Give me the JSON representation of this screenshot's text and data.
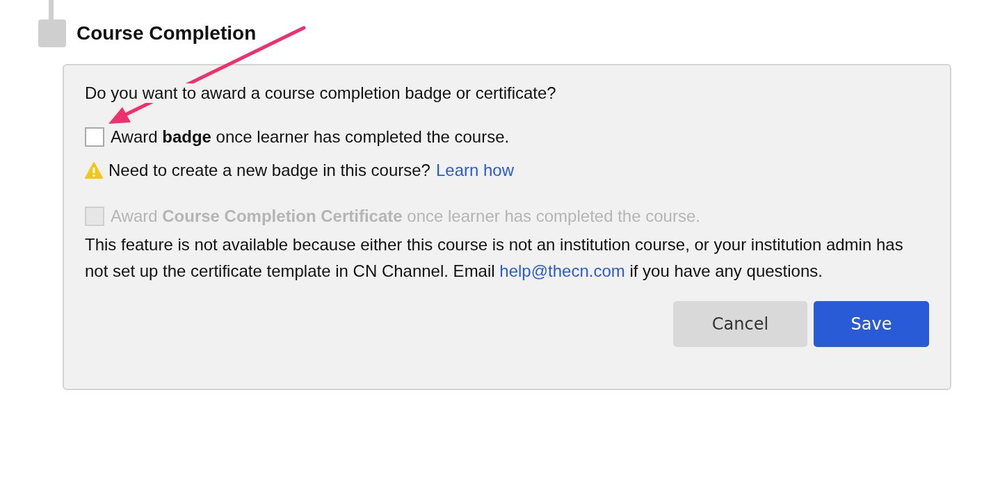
{
  "section": {
    "title": "Course Completion"
  },
  "panel": {
    "question": "Do you want to award a course completion badge or certificate?",
    "options": [
      {
        "kind": "badge",
        "label": "Award **badge** once learner has completed the course.",
        "checked": false,
        "disabled": false,
        "warning": {
          "text": "Need to create a new badge in this course?",
          "link": "Learn how"
        }
      },
      {
        "kind": "certificate",
        "label": "Award **Course Completion Certificate** once learner has completed the course.",
        "checked": false,
        "disabled": true,
        "note": {
          "before": "This feature is not available because either this course is not an institution course, or your institution admin has not set up the certificate template in CN Channel. Email",
          "link": "help@thecn.com",
          "after": "if you have any questions."
        }
      }
    ],
    "buttons": [
      {
        "kind": "secondary",
        "label": "Cancel"
      },
      {
        "kind": "primary",
        "label": "Save"
      }
    ]
  }
}
